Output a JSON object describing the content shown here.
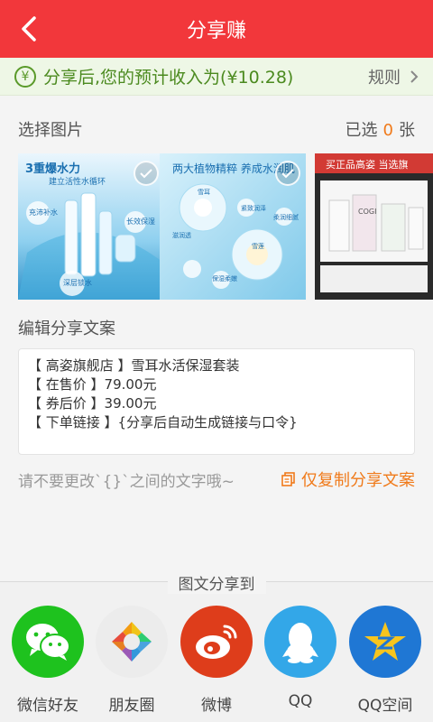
{
  "header": {
    "title": "分享赚"
  },
  "income": {
    "text": "分享后,您的预计收入为(¥10.28)",
    "rules_label": "规则"
  },
  "select": {
    "label": "选择图片",
    "selected_prefix": "已选",
    "selected_count": "0",
    "selected_suffix": "张"
  },
  "images": [
    {
      "caption_main": "3重爆水力",
      "caption_sub": "建立活性水循环",
      "bubbles": [
        "充沛补水",
        "长效保湿",
        "深层锁水"
      ]
    },
    {
      "caption_main": "两大植物精粹 养成水润肌",
      "bubbles": [
        "雪耳",
        "紧致润泽",
        "滋润透",
        "柔润细腻",
        "雪莲",
        "保湿柔嫩"
      ]
    },
    {
      "caption_main": "买正品高姿 当选旗",
      "brand": "COGI"
    }
  ],
  "edit": {
    "label": "编辑分享文案",
    "lines": [
      "【 高姿旗舰店 】雪耳水活保湿套装",
      "【 在售价 】79.00元",
      "【 券后价 】39.00元",
      "【 下单链接 】{分享后自动生成链接与口令}"
    ],
    "hint": "请不要更改`{}`之间的文字哦~",
    "copy_button": "仅复制分享文案"
  },
  "share": {
    "title": "图文分享到",
    "targets": [
      {
        "label": "微信好友",
        "color": "#1ec21e",
        "icon": "wechat-icon"
      },
      {
        "label": "朋友圈",
        "color": "#eeeeee",
        "icon": "moments-icon"
      },
      {
        "label": "微博",
        "color": "#de3d1b",
        "icon": "weibo-icon"
      },
      {
        "label": "QQ",
        "color": "#33a7e8",
        "icon": "qq-icon"
      },
      {
        "label": "QQ空间",
        "color": "#1f77d4",
        "icon": "qzone-icon"
      }
    ]
  },
  "colors": {
    "header": "#f2373b",
    "accent": "#f07a1a",
    "income_green": "#4b8a1f"
  }
}
